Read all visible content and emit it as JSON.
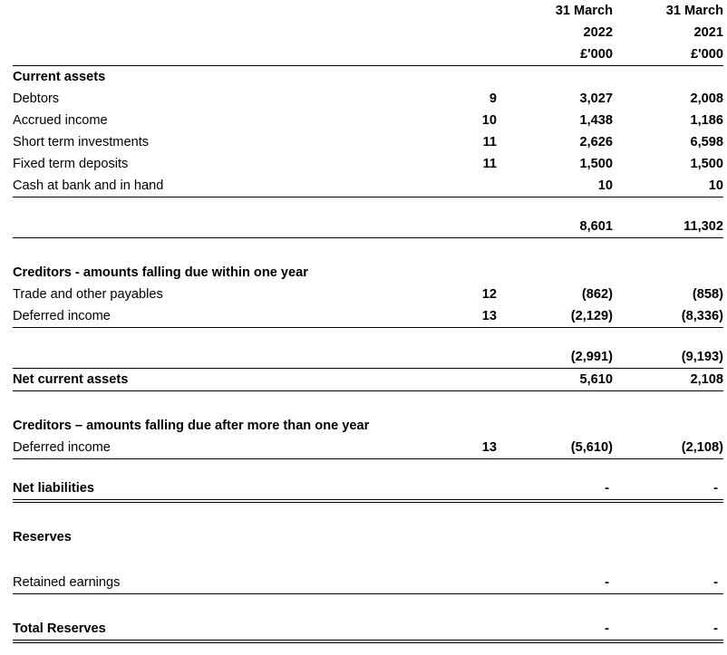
{
  "document": {
    "type": "balance-sheet",
    "currency_unit": "£'000"
  },
  "header": {
    "note_col_label": "",
    "col1": {
      "date": "31 March",
      "year": "2022",
      "unit": "£'000"
    },
    "col2": {
      "date": "31 March",
      "year": "2021",
      "unit": "£'000"
    }
  },
  "sections": {
    "current_assets": {
      "heading": "Current assets",
      "rows": [
        {
          "label": "Debtors",
          "note": "9",
          "y2022": "3,027",
          "y2021": "2,008"
        },
        {
          "label": "Accrued income",
          "note": "10",
          "y2022": "1,438",
          "y2021": "1,186"
        },
        {
          "label": "Short term investments",
          "note": "11",
          "y2022": "2,626",
          "y2021": "6,598"
        },
        {
          "label": "Fixed term deposits",
          "note": "11",
          "y2022": "1,500",
          "y2021": "1,500"
        },
        {
          "label": "Cash at bank and in hand",
          "note": "",
          "y2022": "10",
          "y2021": "10"
        }
      ],
      "total": {
        "label": "",
        "note": "",
        "y2022": "8,601",
        "y2021": "11,302"
      }
    },
    "creditors_within_one_year": {
      "heading": "Creditors - amounts falling due within one year",
      "rows": [
        {
          "label": "Trade and other payables",
          "note": "12",
          "y2022": "(862)",
          "y2021": "(858)"
        },
        {
          "label": "Deferred income",
          "note": "13",
          "y2022": "(2,129)",
          "y2021": "(8,336)"
        }
      ],
      "total": {
        "label": "",
        "note": "",
        "y2022": "(2,991)",
        "y2021": "(9,193)"
      }
    },
    "net_current_assets": {
      "label": "Net current assets",
      "note": "",
      "y2022": "5,610",
      "y2021": "2,108"
    },
    "creditors_after_one_year": {
      "heading": "Creditors – amounts falling due after more than one year",
      "rows": [
        {
          "label": "Deferred income",
          "note": "13",
          "y2022": "(5,610)",
          "y2021": "(2,108)"
        }
      ]
    },
    "net_liabilities": {
      "label": "Net liabilities",
      "note": "",
      "y2022": "-",
      "y2021": "-"
    },
    "reserves": {
      "heading": "Reserves",
      "rows": [
        {
          "label": "Retained earnings",
          "note": "",
          "y2022": "-",
          "y2021": "-"
        }
      ],
      "total": {
        "label": "Total Reserves",
        "note": "",
        "y2022": "-",
        "y2021": "-"
      }
    }
  }
}
